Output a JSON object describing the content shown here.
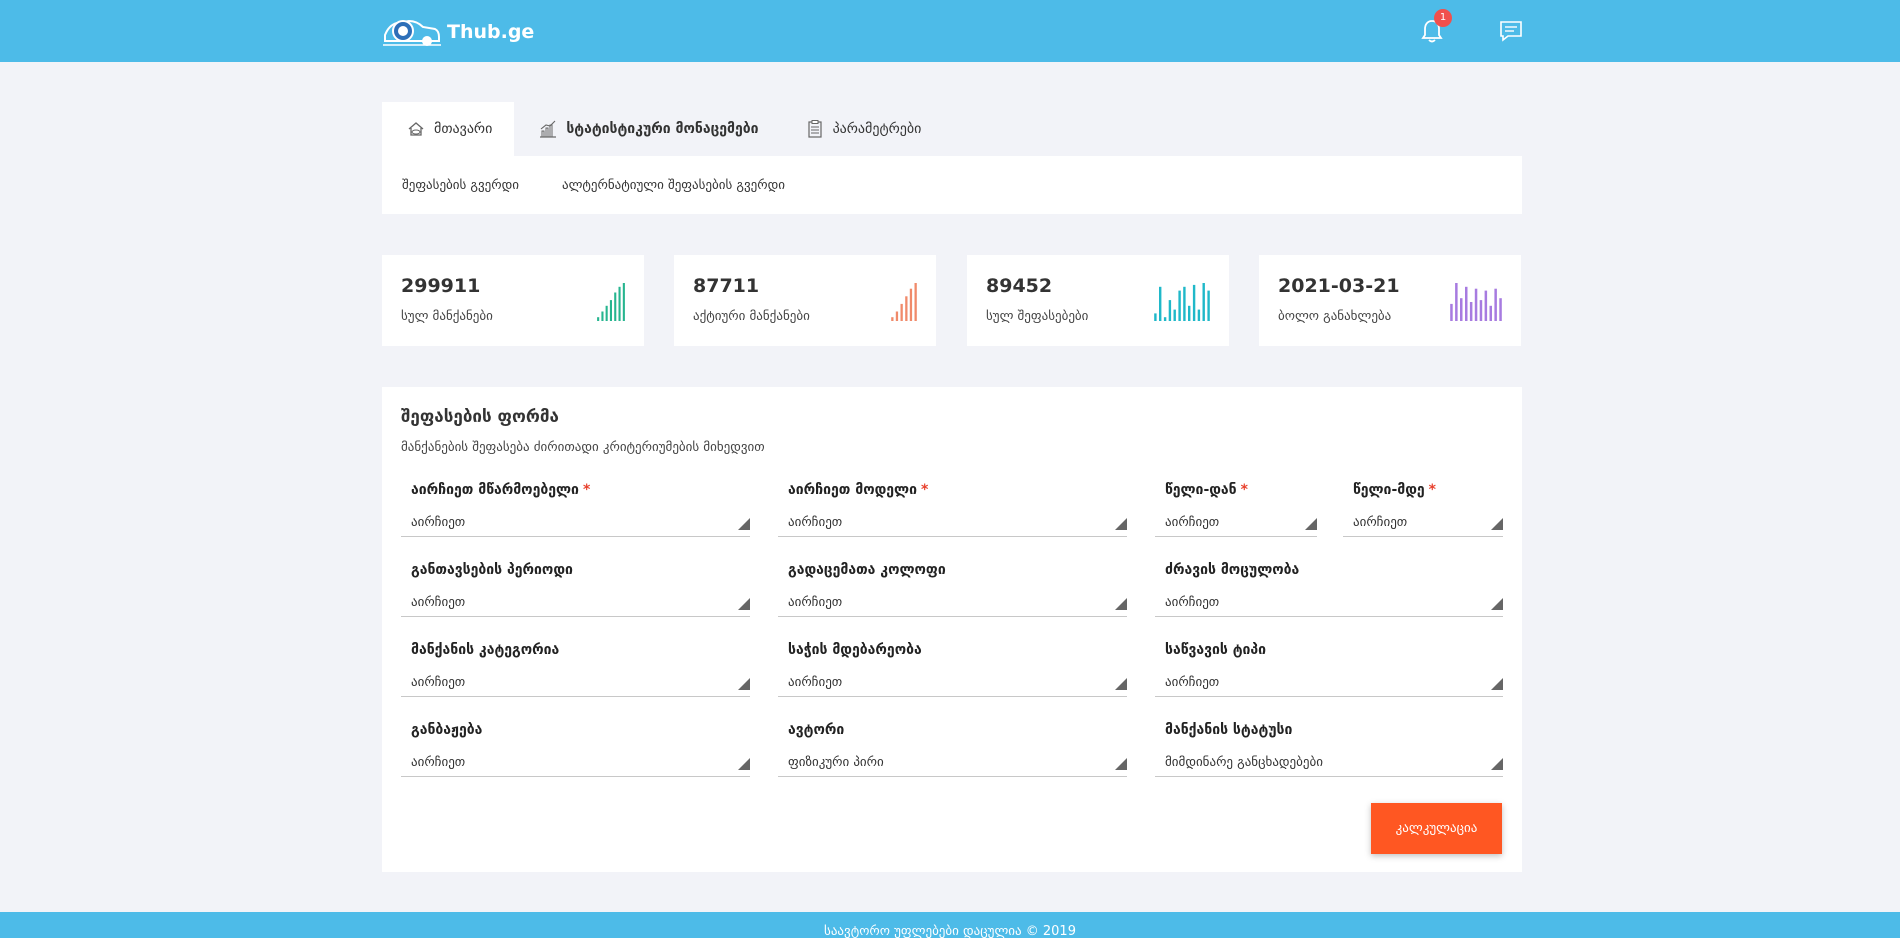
{
  "header": {
    "logo_text": "Thub.ge",
    "notification_count": "1",
    "icons": [
      "bell-icon",
      "chat-icon"
    ]
  },
  "tabs": [
    {
      "label": "მთავარი",
      "icon": "home-icon",
      "active": true
    },
    {
      "label": "სტატისტიკური მონაცემები",
      "icon": "chart-icon",
      "active": false
    },
    {
      "label": "პარამეტრები",
      "icon": "clipboard-icon",
      "active": false
    }
  ],
  "subtabs": [
    "შეფასების გვერდი",
    "ალტერნატიული შეფასების გვერდი"
  ],
  "stats": [
    {
      "value": "299911",
      "label": "სულ მანქანები",
      "color": "#26b58f",
      "bars": [
        0.1,
        0.25,
        0.4,
        0.55,
        0.75,
        0.9,
        1.0
      ]
    },
    {
      "value": "87711",
      "label": "აქტიური მანქანები",
      "color": "#f08a6a",
      "bars": [
        0.1,
        0.25,
        0.45,
        0.65,
        0.85,
        1.0
      ]
    },
    {
      "value": "89452",
      "label": "სულ შეფასებები",
      "color": "#1fb8c9",
      "bars": [
        0.2,
        0.9,
        0.1,
        0.55,
        0.3,
        0.8,
        0.9,
        0.4,
        0.95,
        0.3,
        1.0,
        0.8
      ]
    },
    {
      "value": "2021-03-21",
      "label": "ბოლო განახლება",
      "color": "#a77be0",
      "bars": [
        0.45,
        1.0,
        0.6,
        0.9,
        0.5,
        0.85,
        0.55,
        0.8,
        0.4,
        0.85,
        0.6
      ]
    }
  ],
  "form": {
    "title": "შეფასების ფორმა",
    "subtitle": "მანქანების შეფასება ძირითადი კრიტერიუმების მიხედვით",
    "required_mark": "*",
    "fields": [
      {
        "label": "აირჩიეთ მწარმოებელი",
        "value": "აირჩიეთ",
        "required": true
      },
      {
        "label": "აირჩიეთ მოდელი",
        "value": "აირჩიეთ",
        "required": true
      },
      {
        "label": "წელი-დან",
        "value": "აირჩიეთ",
        "required": true
      },
      {
        "label": "წელი-მდე",
        "value": "აირჩიეთ",
        "required": true
      },
      {
        "label": "განთავსების პერიოდი",
        "value": "აირჩიეთ",
        "required": false
      },
      {
        "label": "გადაცემათა კოლოფი",
        "value": "აირჩიეთ",
        "required": false
      },
      {
        "label": "ძრავის მოცულობა",
        "value": "აირჩიეთ",
        "required": false
      },
      {
        "label": "მანქანის კატეგორია",
        "value": "აირჩიეთ",
        "required": false
      },
      {
        "label": "საჭის მდებარეობა",
        "value": "აირჩიეთ",
        "required": false
      },
      {
        "label": "საწვავის ტიპი",
        "value": "აირჩიეთ",
        "required": false
      },
      {
        "label": "განბაჟება",
        "value": "აირჩიეთ",
        "required": false
      },
      {
        "label": "ავტორი",
        "value": "ფიზიკური პირი",
        "required": false
      },
      {
        "label": "მანქანის სტატუსი",
        "value": "მიმდინარე განცხადებები",
        "required": false
      }
    ],
    "submit_label": "კალკულაცია"
  },
  "footer": {
    "text": "საავტორო უფლებები დაცულია © 2019"
  }
}
